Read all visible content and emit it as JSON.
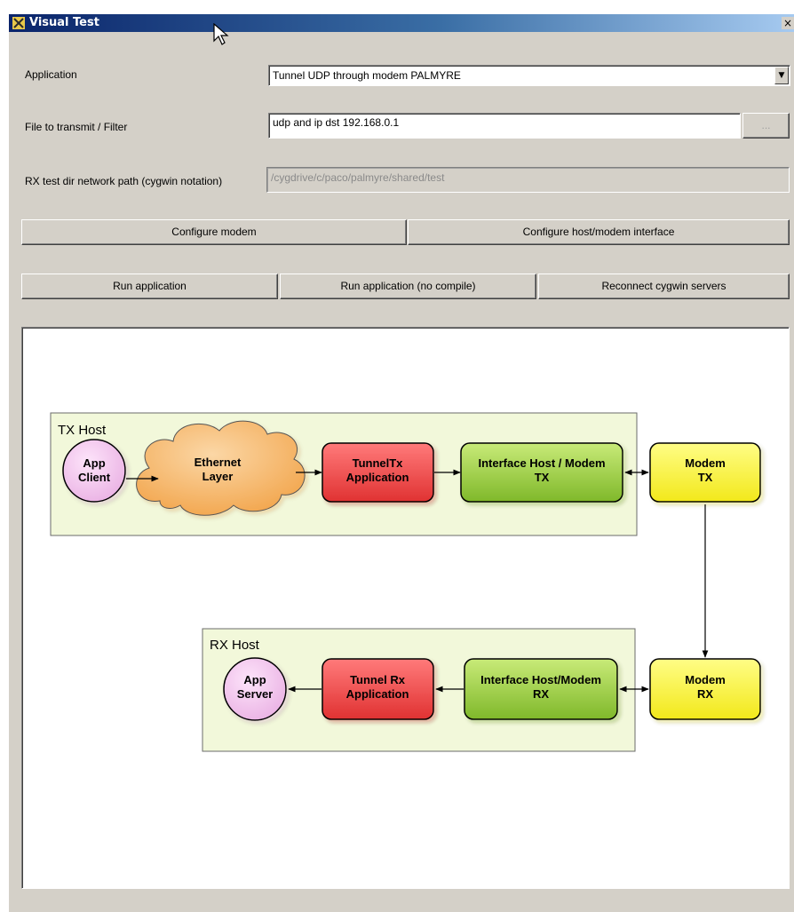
{
  "window": {
    "title": "Visual Test",
    "close_glyph": "×"
  },
  "form": {
    "application": {
      "label": "Application",
      "value": "Tunnel UDP through modem PALMYRE"
    },
    "filter": {
      "label": "File to transmit / Filter",
      "value": "udp and ip dst 192.168.0.1",
      "browse_label": "..."
    },
    "rx_path": {
      "label": "RX test dir network path (cygwin notation)",
      "value": "/cygdrive/c/paco/palmyre/shared/test"
    }
  },
  "buttons": {
    "configure_modem": "Configure modem",
    "configure_interface": "Configure host/modem interface",
    "run_application": "Run application",
    "run_no_compile": "Run application (no compile)",
    "reconnect": "Reconnect cygwin servers"
  },
  "diagram": {
    "tx_host": {
      "label": "TX Host",
      "app_client": [
        "App",
        "Client"
      ],
      "ethernet_layer": [
        "Ethernet",
        "Layer"
      ],
      "tunnel_tx": [
        "TunnelTx",
        "Application"
      ],
      "interface_tx": [
        "Interface Host / Modem",
        "TX"
      ]
    },
    "modem_tx": [
      "Modem",
      "TX"
    ],
    "rx_host": {
      "label": "RX Host",
      "app_server": [
        "App",
        "Server"
      ],
      "tunnel_rx": [
        "Tunnel Rx",
        "Application"
      ],
      "interface_rx": [
        "Interface Host/Modem",
        "RX"
      ]
    },
    "modem_rx": [
      "Modem",
      "RX"
    ],
    "colors": {
      "host_fill": "#f2f8da",
      "client_fill": "#f4c8ee",
      "ethernet_fill": "#f7b96a",
      "app_fill": "#ee4d4d",
      "interface_fill": "#9ccd3c",
      "modem_fill": "#f7f23a"
    }
  }
}
